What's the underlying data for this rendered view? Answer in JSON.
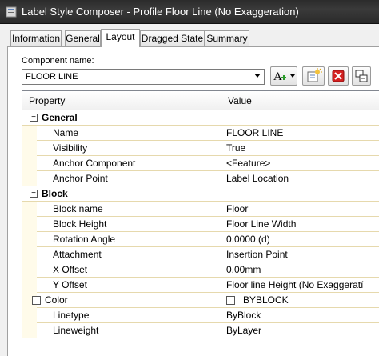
{
  "window": {
    "title": "Label Style Composer - Profile Floor Line (No Exaggeration)"
  },
  "tabs": [
    {
      "label": "Information",
      "active": false
    },
    {
      "label": "General",
      "active": false
    },
    {
      "label": "Layout",
      "active": true
    },
    {
      "label": "Dragged State",
      "active": false
    },
    {
      "label": "Summary",
      "active": false
    }
  ],
  "component": {
    "label": "Component name:",
    "value": "FLOOR LINE"
  },
  "toolbar_icons": [
    "add-component-icon",
    "copy-component-icon",
    "delete-component-icon",
    "draw-order-icon"
  ],
  "grid": {
    "headers": {
      "property": "Property",
      "value": "Value"
    },
    "categories": {
      "general": {
        "label": "General",
        "toggle": "⊟"
      },
      "block": {
        "label": "Block",
        "toggle": "⊟"
      }
    },
    "general_rows": [
      {
        "name": "Name",
        "value": "FLOOR LINE"
      },
      {
        "name": "Visibility",
        "value": "True"
      },
      {
        "name": "Anchor Component",
        "value": "<Feature>"
      },
      {
        "name": "Anchor Point",
        "value": "Label Location"
      }
    ],
    "block_rows": [
      {
        "name": "Block name",
        "value": "Floor"
      },
      {
        "name": "Block Height",
        "value": "Floor Line Width"
      },
      {
        "name": "Rotation Angle",
        "value": "0.0000 (d)"
      },
      {
        "name": "Attachment",
        "value": "Insertion Point"
      },
      {
        "name": "X Offset",
        "value": "0.00mm"
      },
      {
        "name": "Y Offset",
        "value": "Floor line Height (No Exaggeratí"
      },
      {
        "name": "Color",
        "value": "BYBLOCK"
      },
      {
        "name": "Linetype",
        "value": "ByBlock"
      },
      {
        "name": "Lineweight",
        "value": "ByLayer"
      }
    ]
  },
  "colors": {
    "title_bar": "#2b2b2b",
    "grid_line": "#e6d9ad",
    "gutter": "#fffbea",
    "delete_red": "#d42020"
  }
}
